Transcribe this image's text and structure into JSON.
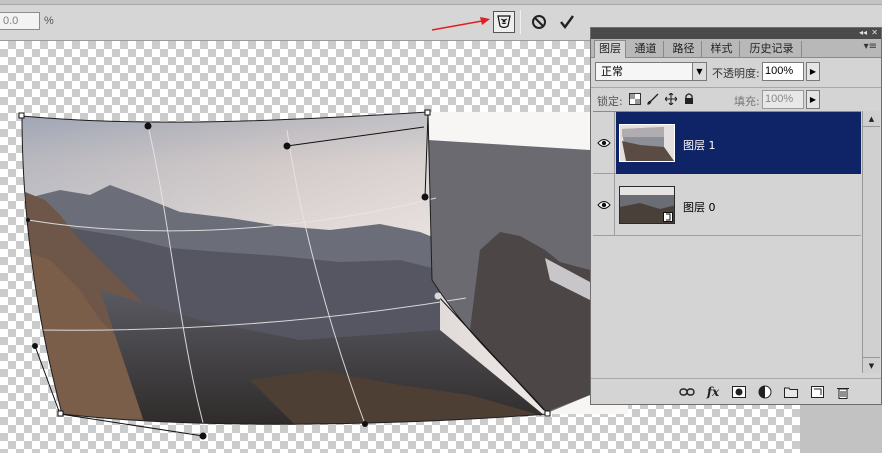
{
  "options_bar": {
    "value": "0.0",
    "unit": "%",
    "warp_mode_icon": "warp-mode-icon",
    "cancel_icon": "cancel-icon",
    "commit_icon": "checkmark-icon"
  },
  "layers_panel": {
    "tabs": [
      {
        "label": "图层",
        "active": true
      },
      {
        "label": "通道",
        "active": false
      },
      {
        "label": "路径",
        "active": false
      },
      {
        "label": "样式",
        "active": false
      },
      {
        "label": "历史记录",
        "active": false
      }
    ],
    "blend_mode": "正常",
    "opacity_label": "不透明度:",
    "opacity_value": "100%",
    "lock_label": "锁定:",
    "fill_label": "填充:",
    "fill_value": "100%",
    "layers": [
      {
        "name": "图层 1",
        "selected": true,
        "visible": true
      },
      {
        "name": "图层 0",
        "selected": false,
        "visible": true
      }
    ]
  },
  "colors": {
    "selected_layer": "#0f2467",
    "annotation_arrow": "#e02020",
    "panel_bg": "#d4d4d4"
  }
}
